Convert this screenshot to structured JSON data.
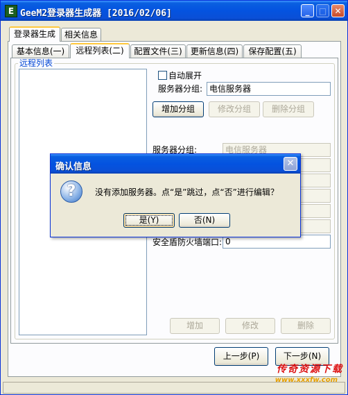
{
  "window": {
    "title": "GeeM2登录器生成器 [2016/02/06]",
    "logo_letter": "E",
    "controls": {
      "minimize": "_",
      "maximize": "□",
      "close": "✕"
    }
  },
  "outer_tabs": [
    {
      "label": "登录器生成",
      "active": true
    },
    {
      "label": "相关信息",
      "active": false
    }
  ],
  "inner_tabs": [
    {
      "label": "基本信息(一)",
      "active": false
    },
    {
      "label": "远程列表(二)",
      "active": true
    },
    {
      "label": "配置文件(三)",
      "active": false
    },
    {
      "label": "更新信息(四)",
      "active": false
    },
    {
      "label": "保存配置(五)",
      "active": false
    }
  ],
  "remote_list": {
    "group_label": "远程列表",
    "checkbox_label": "自动展开",
    "server_group_label": "服务器分组:",
    "server_group_value": "电信服务器",
    "buttons": {
      "add_group": "增加分组",
      "edit_group": "修改分组",
      "delete_group": "删除分组"
    },
    "detail_group_label": "服务器分组:",
    "detail_group_value": "电信服务器",
    "firewall_label": "安全盾防火墙端口:",
    "firewall_value": "0",
    "list_buttons": {
      "add": "增加",
      "edit": "修改",
      "delete": "删除"
    }
  },
  "footer": {
    "prev": "上一步(P)",
    "next": "下一步(N)"
  },
  "dialog": {
    "title": "确认信息",
    "close": "✕",
    "icon": "question-icon",
    "icon_glyph": "?",
    "message": "没有添加服务器。点“是”跳过，点“否”进行编辑？",
    "yes": "是(Y)",
    "no": "否(N)"
  },
  "watermark": {
    "text": "传奇资源下载",
    "url": "www.xxxfw.com"
  }
}
